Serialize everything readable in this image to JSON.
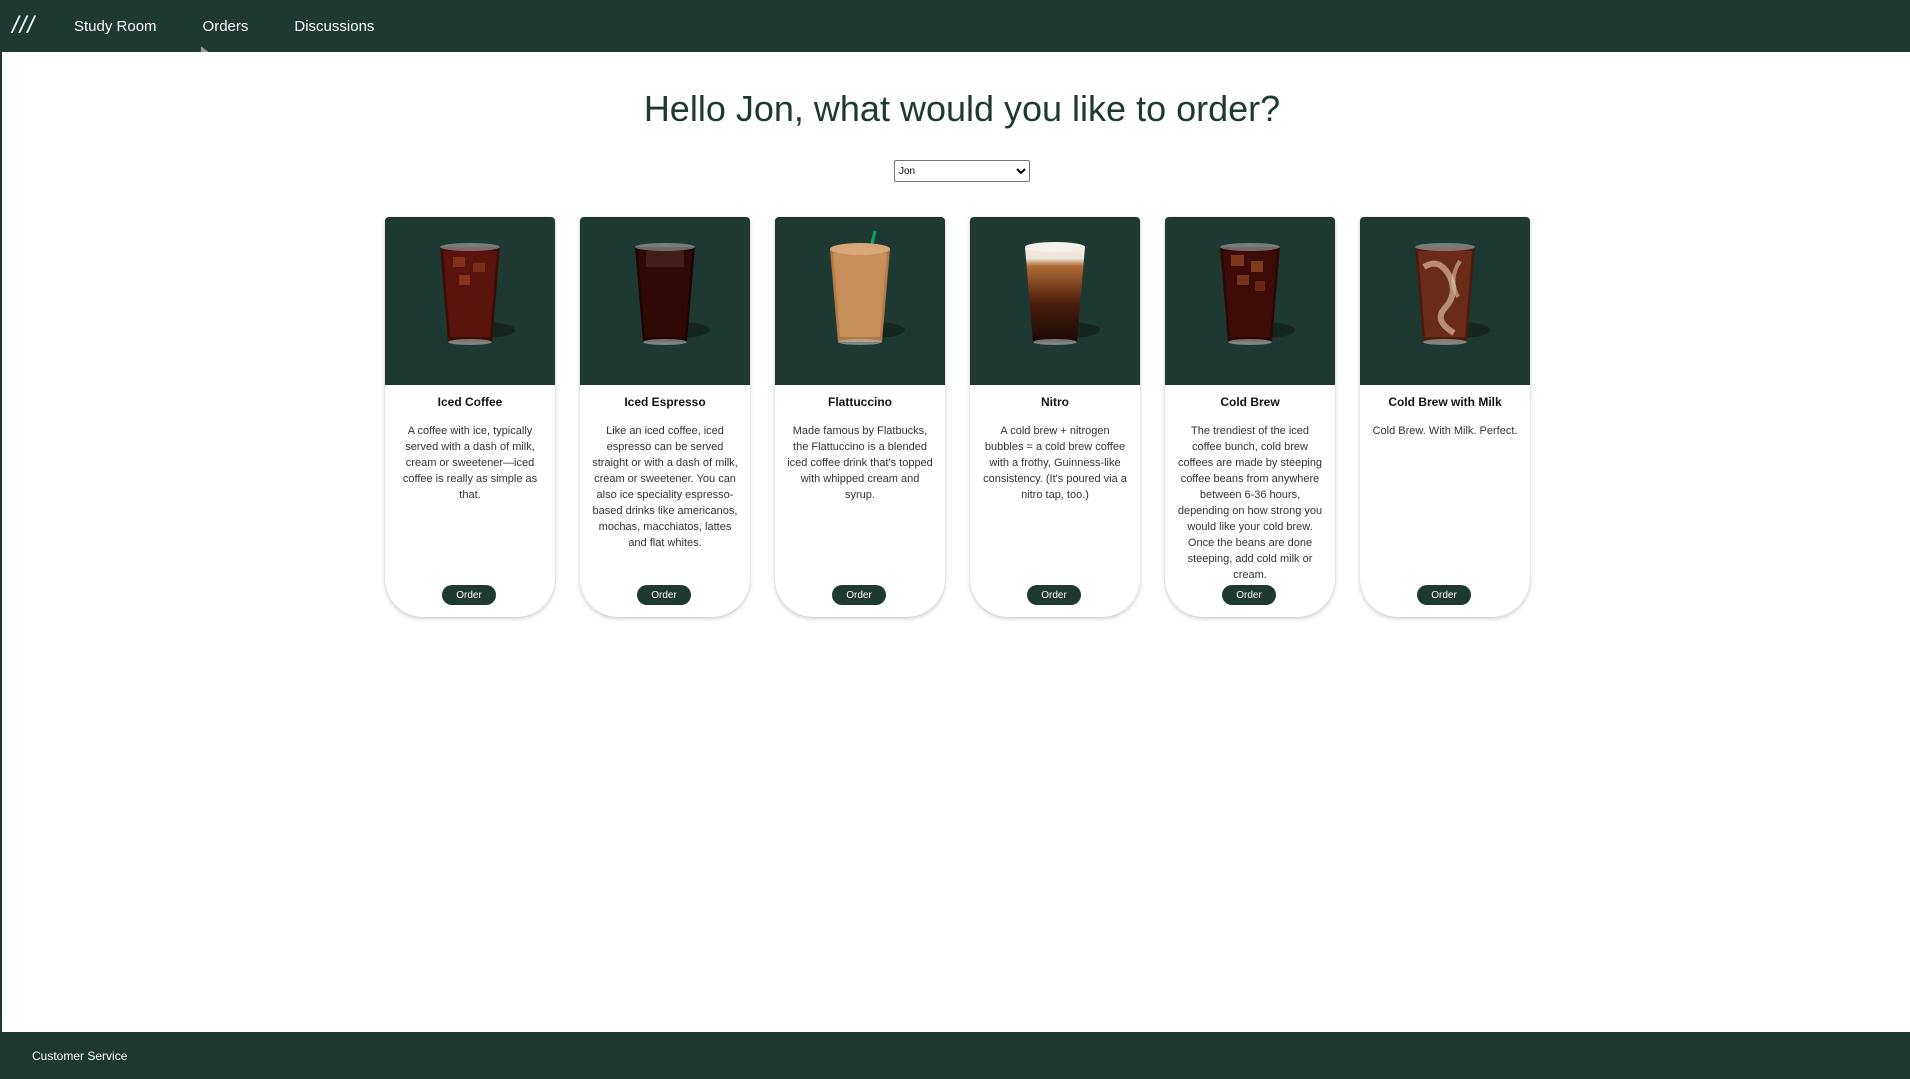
{
  "nav": {
    "logo_text": "///",
    "links": [
      "Study Room",
      "Orders",
      "Discussions"
    ]
  },
  "main": {
    "title": "Hello Jon, what would you like to order?",
    "user_select": {
      "selected": "Jon",
      "options": [
        "Jon"
      ]
    }
  },
  "drinks": [
    {
      "name": "Iced Coffee",
      "description": "A coffee with ice, typically served with a dash of milk, cream or sweetener—iced coffee is really as simple as that.",
      "button": "Order",
      "icon": "iced-coffee-drink-icon"
    },
    {
      "name": "Iced Espresso",
      "description": "Like an iced coffee, iced espresso can be served straight or with a dash of milk, cream or sweetener. You can also ice speciality espresso-based drinks like americanos, mochas, macchiatos, lattes and flat whites.",
      "button": "Order",
      "icon": "iced-espresso-drink-icon"
    },
    {
      "name": "Flattuccino",
      "description": "Made famous by Flatbucks, the Flattuccino is a blended iced coffee drink that's topped with whipped cream and syrup.",
      "button": "Order",
      "icon": "flattuccino-drink-icon"
    },
    {
      "name": "Nitro",
      "description": "A cold brew + nitrogen bubbles = a cold brew coffee with a frothy, Guinness-like consistency. (It's poured via a nitro tap, too.)",
      "button": "Order",
      "icon": "nitro-drink-icon"
    },
    {
      "name": "Cold Brew",
      "description": "The trendiest of the iced coffee bunch, cold brew coffees are made by steeping coffee beans from anywhere between 6-36 hours, depending on how strong you would like your cold brew. Once the beans are done steeping, add cold milk or cream.",
      "button": "Order",
      "icon": "cold-brew-drink-icon"
    },
    {
      "name": "Cold Brew with Milk",
      "description": "Cold Brew. With Milk. Perfect.",
      "button": "Order",
      "icon": "cold-brew-milk-drink-icon"
    }
  ],
  "footer": {
    "link": "Customer Service"
  },
  "colors": {
    "brand": "#1e3932",
    "background": "#ffffff"
  }
}
